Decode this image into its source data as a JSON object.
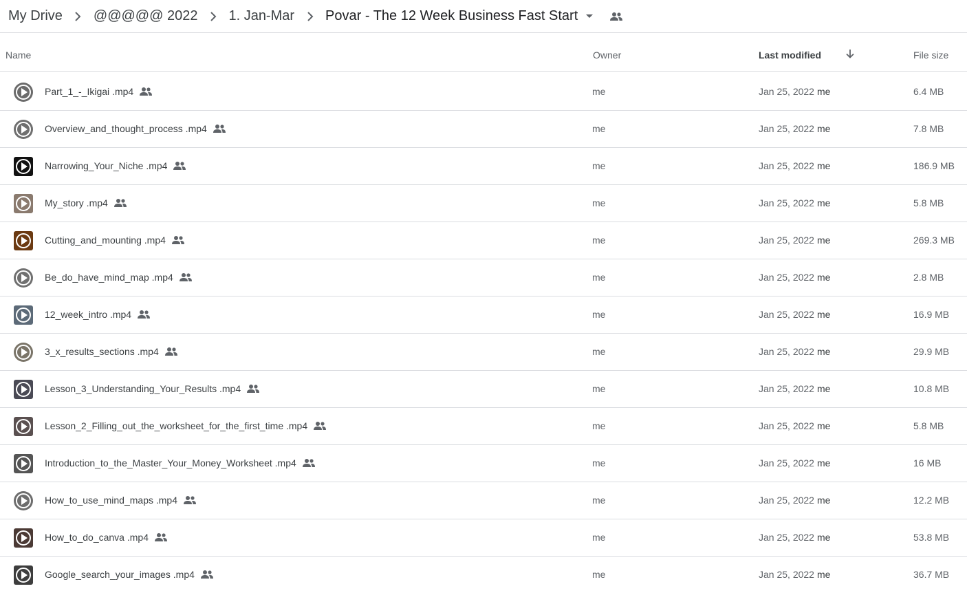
{
  "breadcrumb": {
    "items": [
      "My Drive",
      "@@@@@ 2022",
      "1. Jan-Mar",
      "Povar - The 12 Week Business Fast Start"
    ]
  },
  "icons": {
    "separator": "chevron-right-icon",
    "dropdown": "arrow-drop-down-icon",
    "shared": "people-icon",
    "sort": "arrow-down-icon",
    "thumbnail": "video-play-icon"
  },
  "table": {
    "columns": {
      "name": "Name",
      "owner": "Owner",
      "last_modified": "Last modified",
      "file_size": "File size"
    },
    "sort": {
      "column": "Last modified",
      "direction": "descending"
    },
    "rows": [
      {
        "name": "Part_1_-_Ikigai .mp4",
        "owner": "me",
        "modified": "Jan 25, 2022",
        "modified_by": "me",
        "size": "6.4 MB",
        "thumb": "#6b6b6b"
      },
      {
        "name": "Overview_and_thought_process .mp4",
        "owner": "me",
        "modified": "Jan 25, 2022",
        "modified_by": "me",
        "size": "7.8 MB",
        "thumb": "#6f6f6f"
      },
      {
        "name": "Narrowing_Your_Niche .mp4",
        "owner": "me",
        "modified": "Jan 25, 2022",
        "modified_by": "me",
        "size": "186.9 MB",
        "thumb": "#111111"
      },
      {
        "name": "My_story .mp4",
        "owner": "me",
        "modified": "Jan 25, 2022",
        "modified_by": "me",
        "size": "5.8 MB",
        "thumb": "#8a7a6e"
      },
      {
        "name": "Cutting_and_mounting .mp4",
        "owner": "me",
        "modified": "Jan 25, 2022",
        "modified_by": "me",
        "size": "269.3 MB",
        "thumb": "#6b3a12"
      },
      {
        "name": "Be_do_have_mind_map .mp4",
        "owner": "me",
        "modified": "Jan 25, 2022",
        "modified_by": "me",
        "size": "2.8 MB",
        "thumb": "#707070"
      },
      {
        "name": "12_week_intro .mp4",
        "owner": "me",
        "modified": "Jan 25, 2022",
        "modified_by": "me",
        "size": "16.9 MB",
        "thumb": "#5c6a78"
      },
      {
        "name": "3_x_results_sections .mp4",
        "owner": "me",
        "modified": "Jan 25, 2022",
        "modified_by": "me",
        "size": "29.9 MB",
        "thumb": "#7a7468"
      },
      {
        "name": "Lesson_3_Understanding_Your_Results .mp4",
        "owner": "me",
        "modified": "Jan 25, 2022",
        "modified_by": "me",
        "size": "10.8 MB",
        "thumb": "#4a4a55"
      },
      {
        "name": "Lesson_2_Filling_out_the_worksheet_for_the_first_time .mp4",
        "owner": "me",
        "modified": "Jan 25, 2022",
        "modified_by": "me",
        "size": "5.8 MB",
        "thumb": "#5a5050"
      },
      {
        "name": "Introduction_to_the_Master_Your_Money_Worksheet .mp4",
        "owner": "me",
        "modified": "Jan 25, 2022",
        "modified_by": "me",
        "size": "16 MB",
        "thumb": "#555555"
      },
      {
        "name": "How_to_use_mind_maps .mp4",
        "owner": "me",
        "modified": "Jan 25, 2022",
        "modified_by": "me",
        "size": "12.2 MB",
        "thumb": "#6d6d6d"
      },
      {
        "name": "How_to_do_canva .mp4",
        "owner": "me",
        "modified": "Jan 25, 2022",
        "modified_by": "me",
        "size": "53.8 MB",
        "thumb": "#4b3a35"
      },
      {
        "name": "Google_search_your_images .mp4",
        "owner": "me",
        "modified": "Jan 25, 2022",
        "modified_by": "me",
        "size": "36.7 MB",
        "thumb": "#3d3d3d"
      }
    ]
  }
}
